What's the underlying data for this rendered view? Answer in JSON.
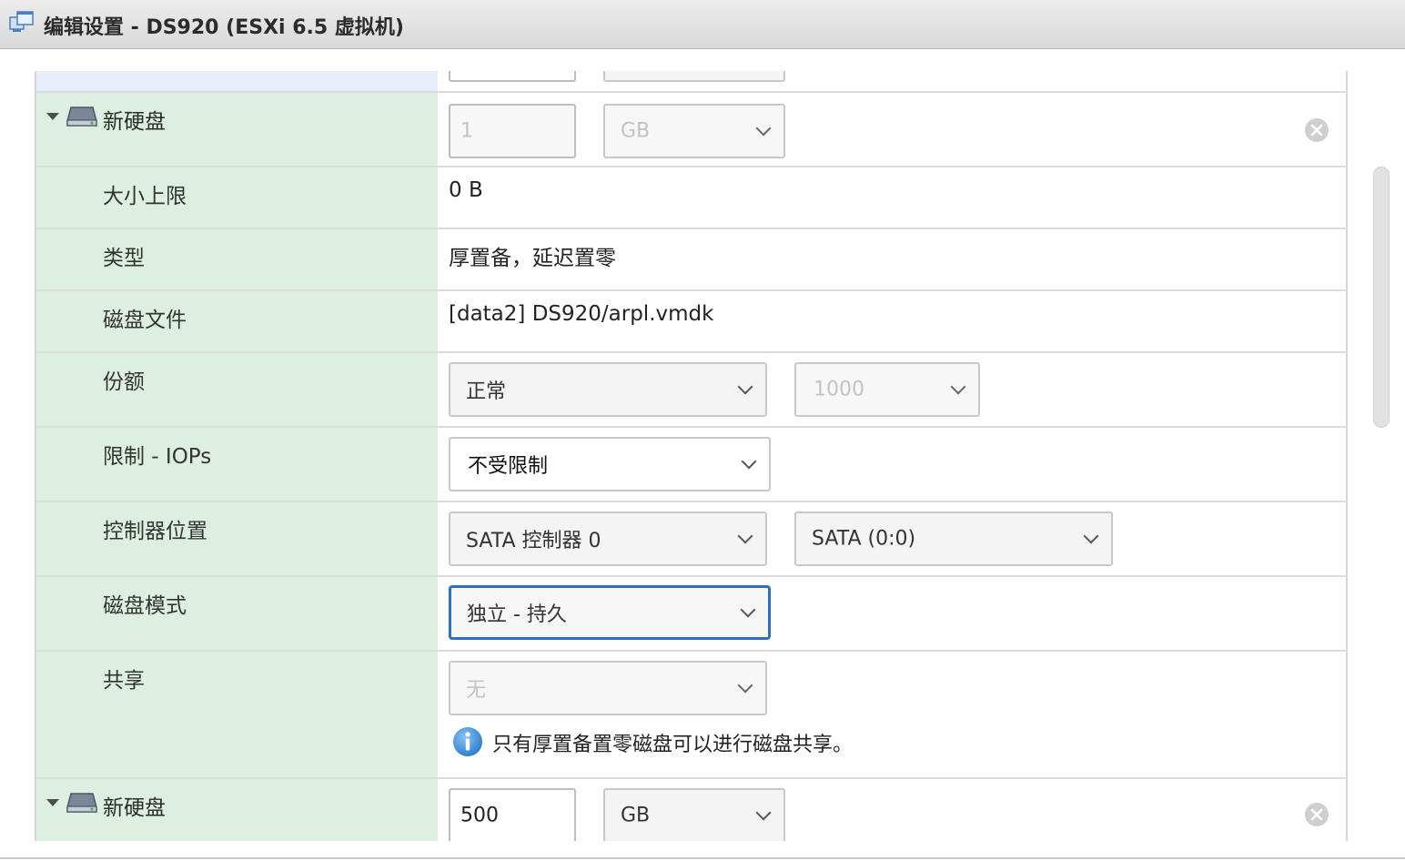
{
  "window": {
    "title": "编辑设置 - DS920 (ESXi 6.5 虚拟机)",
    "icon": "vm-settings-icon"
  },
  "disk1": {
    "header_label": "新硬盘",
    "size_value": "1",
    "size_unit": "GB",
    "rows": {
      "max_size": {
        "label": "大小上限",
        "value": "0 B"
      },
      "type": {
        "label": "类型",
        "value": "厚置备，延迟置零"
      },
      "disk_file": {
        "label": "磁盘文件",
        "value": "[data2] DS920/arpl.vmdk"
      },
      "shares": {
        "label": "份额",
        "level": "正常",
        "value": "1000"
      },
      "limit_iops": {
        "label": "限制 - IOPs",
        "value": "不受限制"
      },
      "controller": {
        "label": "控制器位置",
        "controller": "SATA 控制器 0",
        "slot": "SATA (0:0)"
      },
      "disk_mode": {
        "label": "磁盘模式",
        "value": "独立 - 持久"
      },
      "sharing": {
        "label": "共享",
        "value": "无",
        "info": "只有厚置备置零磁盘可以进行磁盘共享。"
      }
    }
  },
  "disk2": {
    "header_label": "新硬盘",
    "size_value": "500",
    "size_unit": "GB"
  },
  "colors": {
    "label_bg": "#ddefde",
    "focus_border": "#2c6fc4",
    "info_blue": "#3f8fd6"
  }
}
